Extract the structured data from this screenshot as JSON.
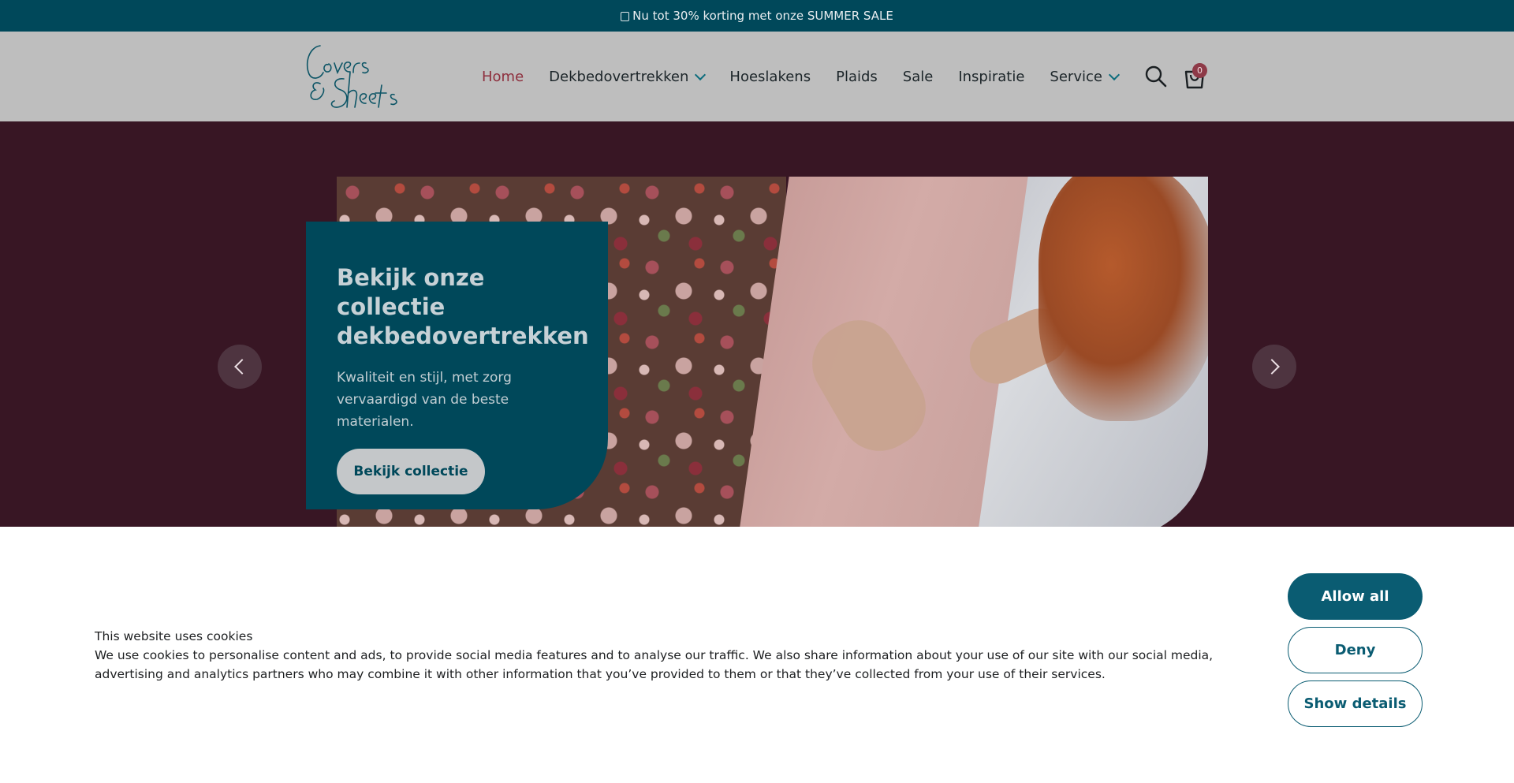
{
  "announcement": {
    "text": "Nu tot 30% korting met onze SUMMER SALE",
    "icon": "bag-icon"
  },
  "header": {
    "logo_text": "Covers & Sheets",
    "nav": [
      {
        "label": "Home",
        "active": true
      },
      {
        "label": "Dekbedovertrekken",
        "dropdown": true
      },
      {
        "label": "Hoeslakens"
      },
      {
        "label": "Plaids"
      },
      {
        "label": "Sale"
      },
      {
        "label": "Inspiratie"
      },
      {
        "label": "Service",
        "dropdown": true
      }
    ],
    "cart_count": "0"
  },
  "hero": {
    "title": "Bekijk onze collectie dekbedovertrekken",
    "subtitle": "Kwaliteit en stijl, met zorg vervaardigd van de beste materialen.",
    "cta": "Bekijk collectie"
  },
  "cookie": {
    "title": "This website uses cookies",
    "body": "We use cookies to personalise content and ads, to provide social media features and to analyse our traffic. We also share information about your use of our site with our social media, advertising and analytics partners who may combine it with other information that you’ve provided to them or that they’ve collected from your use of their services.",
    "allow": "Allow all",
    "deny": "Deny",
    "details": "Show details"
  },
  "colors": {
    "brand": "#00485a",
    "hero_bg": "#381624",
    "accent": "#8e2f3d",
    "header_bg": "#bebebe"
  }
}
